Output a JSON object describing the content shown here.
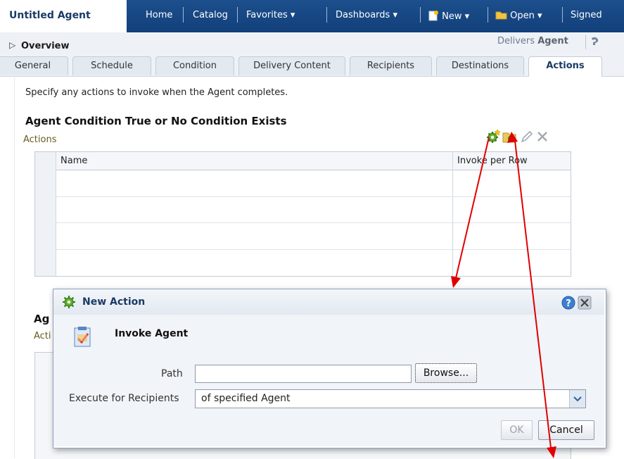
{
  "header": {
    "app_title": "Untitled Agent",
    "nav": {
      "home": "Home",
      "catalog": "Catalog",
      "favorites": "Favorites",
      "dashboards": "Dashboards",
      "new": "New",
      "open": "Open",
      "signed": "Signed"
    }
  },
  "overview": {
    "label": "Overview",
    "delivers_prefix": "Delivers",
    "delivers_bold": "Agent"
  },
  "tabs": [
    {
      "label": "General"
    },
    {
      "label": "Schedule"
    },
    {
      "label": "Condition"
    },
    {
      "label": "Delivery Content"
    },
    {
      "label": "Recipients"
    },
    {
      "label": "Destinations"
    },
    {
      "label": "Actions",
      "active": true
    }
  ],
  "main": {
    "instructions": "Specify any actions to invoke when the Agent completes.",
    "section_title": "Agent Condition True or No Condition Exists",
    "actions_label": "Actions",
    "table": {
      "columns": [
        "Name",
        "Invoke per Row"
      ],
      "rows": []
    },
    "lower_section_title_partial": "Ag",
    "lower_actions_partial": "Acti"
  },
  "dialog": {
    "title": "New Action",
    "action_title": "Invoke Agent",
    "path_label": "Path",
    "path_value": "",
    "browse_label": "Browse...",
    "execute_label": "Execute for Recipients",
    "execute_value": "of specified Agent",
    "ok_label": "OK",
    "cancel_label": "Cancel"
  },
  "colors": {
    "nav_bg": "#12407b",
    "title_blue": "#1b3a66",
    "annotation_arrow": "#e00000"
  }
}
